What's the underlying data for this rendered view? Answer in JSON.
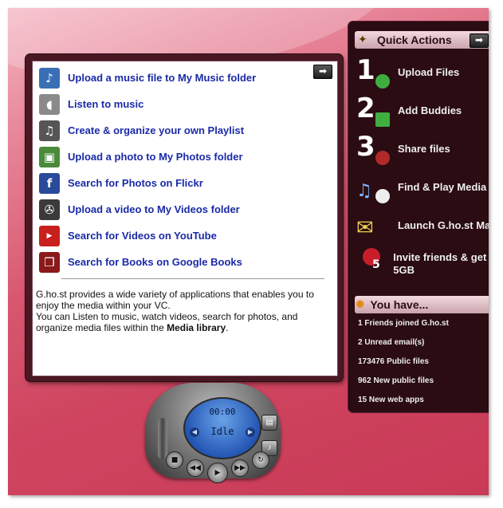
{
  "main_panel": {
    "items": [
      {
        "label": "Upload a music file to My Music folder",
        "icon": "music-note-icon",
        "color": "#3a6fb5"
      },
      {
        "label": "Listen to music",
        "icon": "speaker-icon",
        "color": "#7a7a7a"
      },
      {
        "label": "Create & organize your own Playlist",
        "icon": "playlist-icon",
        "color": "#555555"
      },
      {
        "label": "Upload a photo to My Photos folder",
        "icon": "photo-icon",
        "color": "#4a8a3a"
      },
      {
        "label": "Search for Photos on Flickr",
        "icon": "flickr-icon",
        "color": "#2a4a9a"
      },
      {
        "label": "Upload a video to My Videos folder",
        "icon": "film-reel-icon",
        "color": "#3a3a3a"
      },
      {
        "label": "Search for Videos on YouTube",
        "icon": "youtube-icon",
        "color": "#c8201c"
      },
      {
        "label": "Search for Books on Google Books",
        "icon": "book-icon",
        "color": "#8a1a1a"
      }
    ],
    "description_1": "G.ho.st provides a wide variety of applications that enables you to enjoy the media within your VC.",
    "description_2": "You can Listen to music, watch videos, search for photos, and organize media files within the ",
    "description_bold": "Media library",
    "description_end": "."
  },
  "quick_actions": {
    "title": "Quick Actions",
    "items": [
      {
        "number": "1",
        "label": "Upload Files",
        "icon": "upload-files-icon"
      },
      {
        "number": "2",
        "label": "Add Buddies",
        "icon": "add-buddies-icon"
      },
      {
        "number": "3",
        "label": "Share files",
        "icon": "share-files-icon"
      },
      {
        "number": "",
        "label": "Find & Play Media",
        "icon": "media-icon"
      },
      {
        "number": "",
        "label": "Launch G.ho.st Mail",
        "icon": "mail-icon"
      },
      {
        "number": "5",
        "label": "Invite friends & get 5GB",
        "icon": "invite-icon"
      }
    ]
  },
  "you_have": {
    "title": "You have...",
    "items": [
      "1 Friends joined G.ho.st",
      "2 Unread email(s)",
      "173476 Public files",
      "962 New public files",
      "15 New web apps"
    ]
  },
  "player": {
    "time": "00:00",
    "status": "Idle"
  }
}
